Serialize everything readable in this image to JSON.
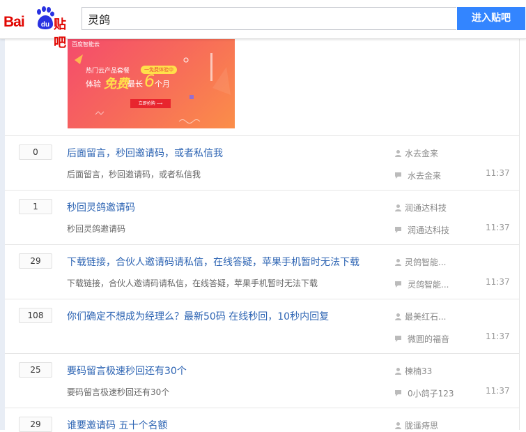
{
  "header": {
    "logo_text": "Bai",
    "logo_du": "du",
    "logo_tieba": "贴吧",
    "search_value": "灵鸽",
    "enter_button": "进入贴吧"
  },
  "ad": {
    "brand": "百度智能云",
    "hot_products": "热门云产品套餐",
    "free_tag": "一免费体验中",
    "experience": "体验",
    "free": "免费",
    "longest": "最长",
    "six": "6",
    "months": "个月",
    "buy_now": "立即抢购 ⟶"
  },
  "threads": [
    {
      "count": "0",
      "title": "后面留言，秒回邀请码，或者私信我",
      "abstract": "后面留言，秒回邀请码，或者私信我",
      "author": "水去金来",
      "last_replier": "水去金来",
      "time": "11:37"
    },
    {
      "count": "1",
      "title": "秒回灵鸽邀请码",
      "abstract": "秒回灵鸽邀请码",
      "author": "润通达科技",
      "last_replier": "润通达科技",
      "time": "11:37"
    },
    {
      "count": "29",
      "title": "下载链接，合伙人邀请码请私信，在线答疑，苹果手机暂时无法下载",
      "abstract": "下载链接，合伙人邀请码请私信，在线答疑，苹果手机暂时无法下载",
      "author": "灵鸽智能...",
      "last_replier": "灵鸽智能...",
      "time": "11:37"
    },
    {
      "count": "108",
      "title": "你们确定不想成为经理么？最新50码 在线秒回，10秒内回复",
      "abstract": "",
      "author": "最美红石...",
      "last_replier": "微圆的福音",
      "time": "11:37"
    },
    {
      "count": "25",
      "title": "要码留言极速秒回还有30个",
      "abstract": "要码留言极速秒回还有30个",
      "author": "楝楠33",
      "last_replier": "0小鸽子123",
      "time": "11:37"
    },
    {
      "count": "29",
      "title": "谁要邀请码 五十个名额",
      "abstract": "",
      "author": "胧遥痔思",
      "last_replier": "",
      "time": ""
    }
  ],
  "colors": {
    "accent": "#3385ff",
    "link": "#2d64b3",
    "brand_red": "#e10601"
  }
}
